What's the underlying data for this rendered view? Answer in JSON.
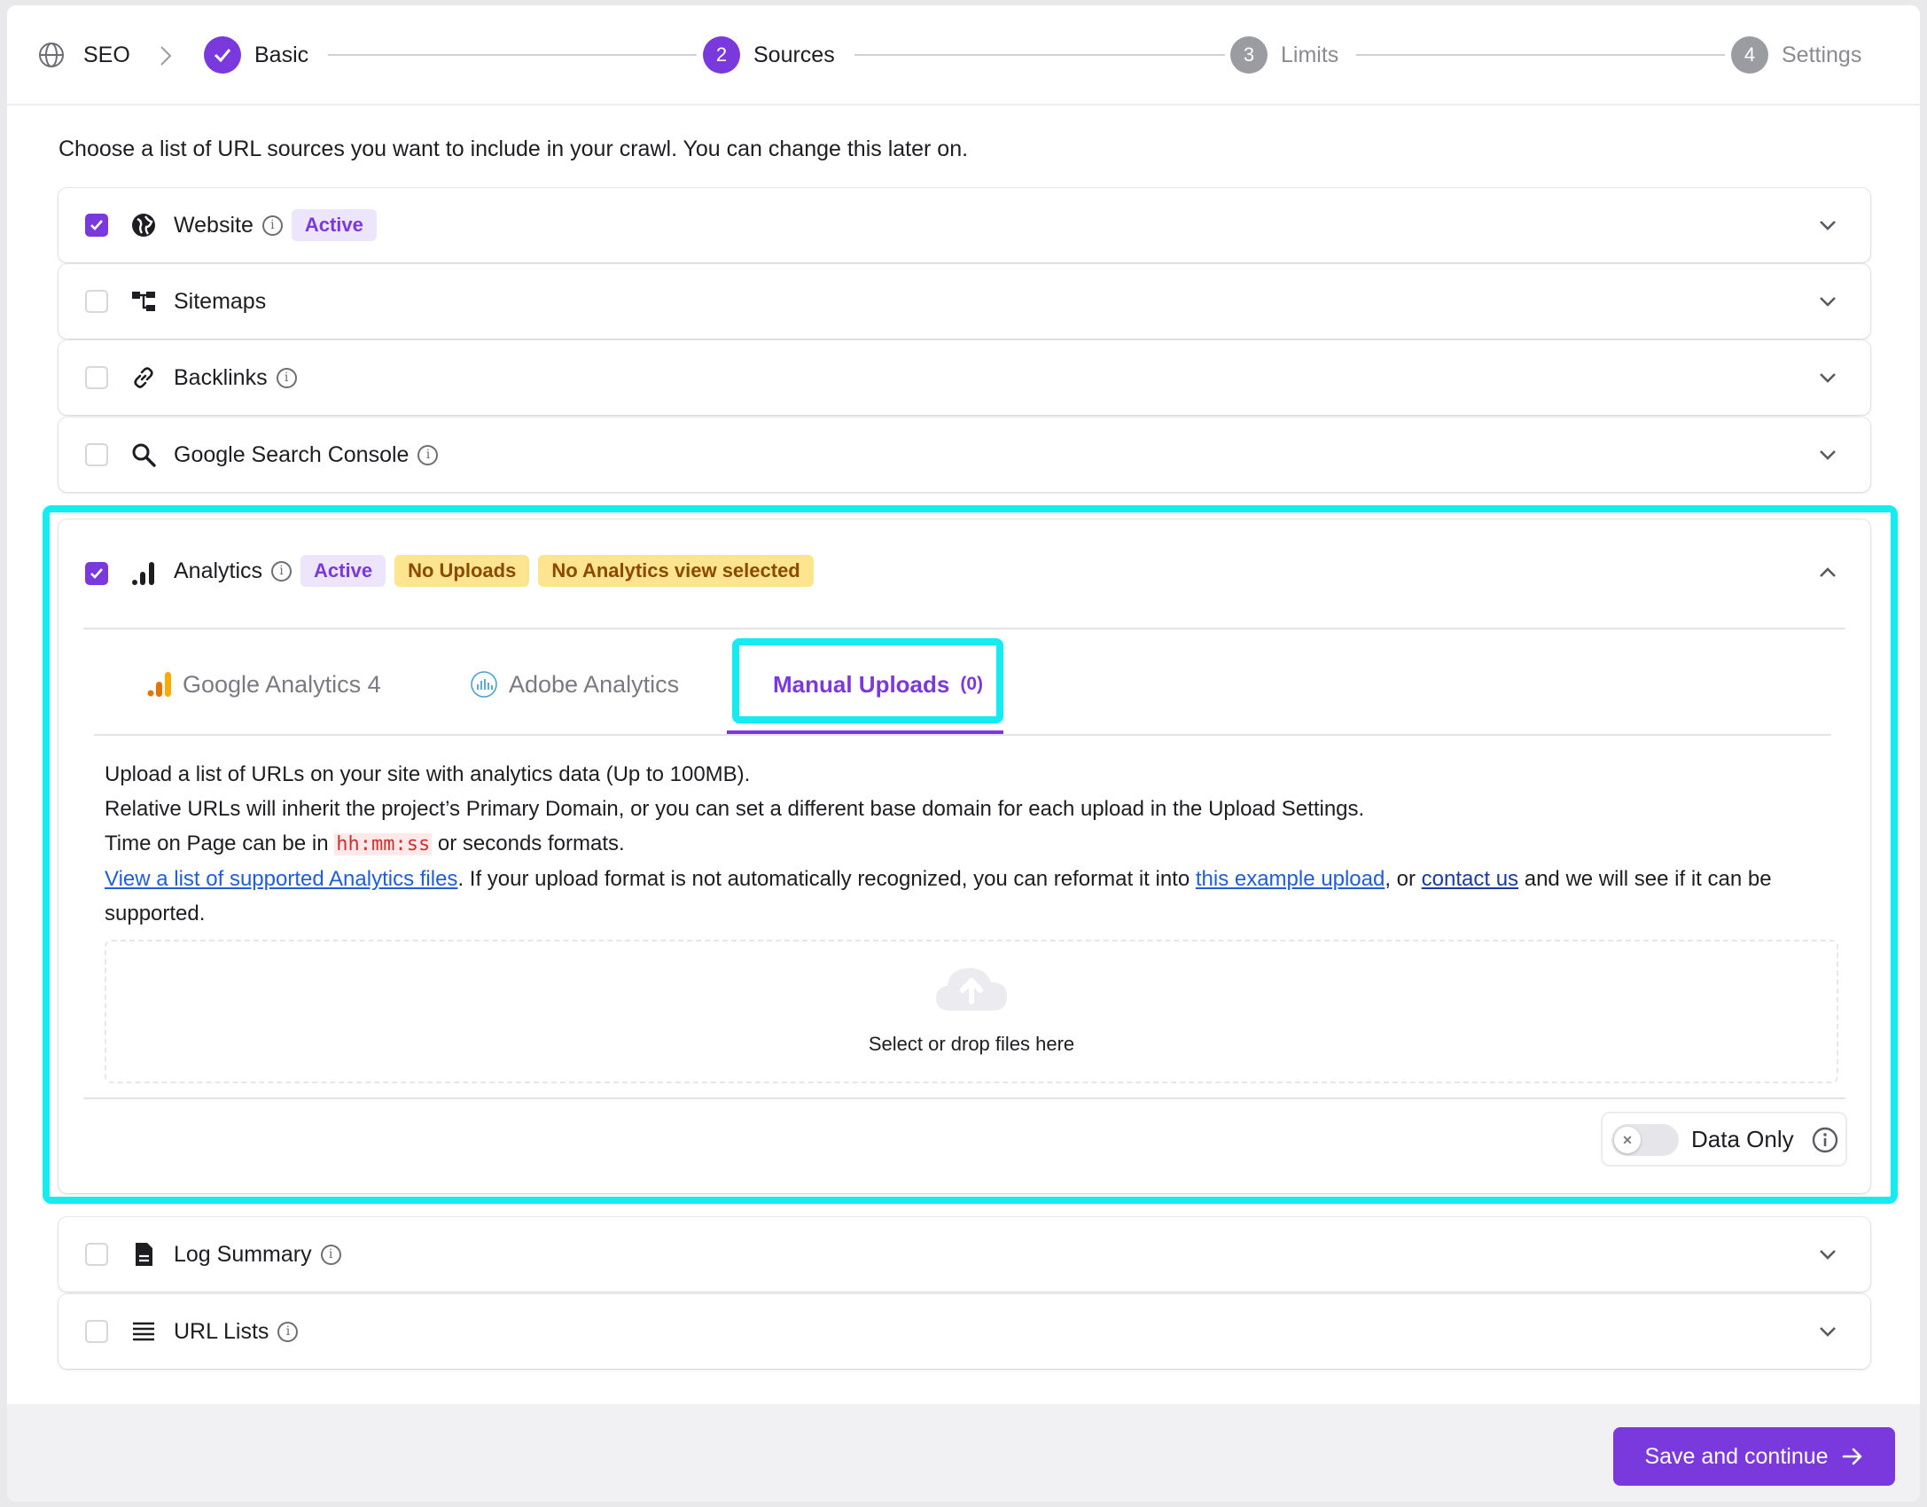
{
  "stepper": {
    "root": "SEO",
    "steps": [
      {
        "number": "",
        "label": "Basic",
        "state": "done"
      },
      {
        "number": "2",
        "label": "Sources",
        "state": "current"
      },
      {
        "number": "3",
        "label": "Limits",
        "state": "upcoming"
      },
      {
        "number": "4",
        "label": "Settings",
        "state": "upcoming"
      }
    ]
  },
  "intro": "Choose a list of URL sources you want to include in your crawl. You can change this later on.",
  "sources": {
    "website": {
      "label": "Website",
      "checked": true,
      "badge": "Active",
      "icon": "globe-icon"
    },
    "sitemaps": {
      "label": "Sitemaps",
      "checked": false,
      "icon": "sitemap-icon"
    },
    "backlinks": {
      "label": "Backlinks",
      "checked": false,
      "icon": "link-icon"
    },
    "gsc": {
      "label": "Google Search Console",
      "checked": false,
      "icon": "search-icon"
    },
    "analytics": {
      "label": "Analytics",
      "checked": true,
      "icon": "bar-chart-icon",
      "badges": {
        "active": "Active",
        "no_uploads": "No Uploads",
        "no_view": "No Analytics view selected"
      },
      "tabs": {
        "ga4": "Google Analytics 4",
        "adobe": "Adobe Analytics",
        "manual": "Manual Uploads",
        "manual_count": "(0)"
      },
      "desc": {
        "line1": "Upload a list of URLs on your site with analytics data (Up to 100MB).",
        "line2": "Relative URLs will inherit the project’s Primary Domain, or you can set a different base domain for each upload in the Upload Settings.",
        "line3_pre": "Time on Page can be in ",
        "line3_code": "hh:mm:ss",
        "line3_post": " or seconds formats.",
        "link1": "View a list of supported Analytics files",
        "line4_mid": ". If your upload format is not automatically recognized, you can reformat it into ",
        "link2": "this example upload",
        "line4_sep": ", or ",
        "link3": "contact us",
        "line4_end": " and we will see if it can be supported."
      },
      "dropzone": "Select or drop files here",
      "data_only": {
        "label": "Data Only",
        "on": false
      }
    },
    "log_summary": {
      "label": "Log Summary",
      "checked": false,
      "icon": "document-icon"
    },
    "url_lists": {
      "label": "URL Lists",
      "checked": false,
      "icon": "list-icon"
    }
  },
  "footer": {
    "save_label": "Save and continue"
  },
  "colors": {
    "accent": "#7a39dc",
    "highlight": "#14ecf2",
    "warn_bg": "#fde58f"
  }
}
